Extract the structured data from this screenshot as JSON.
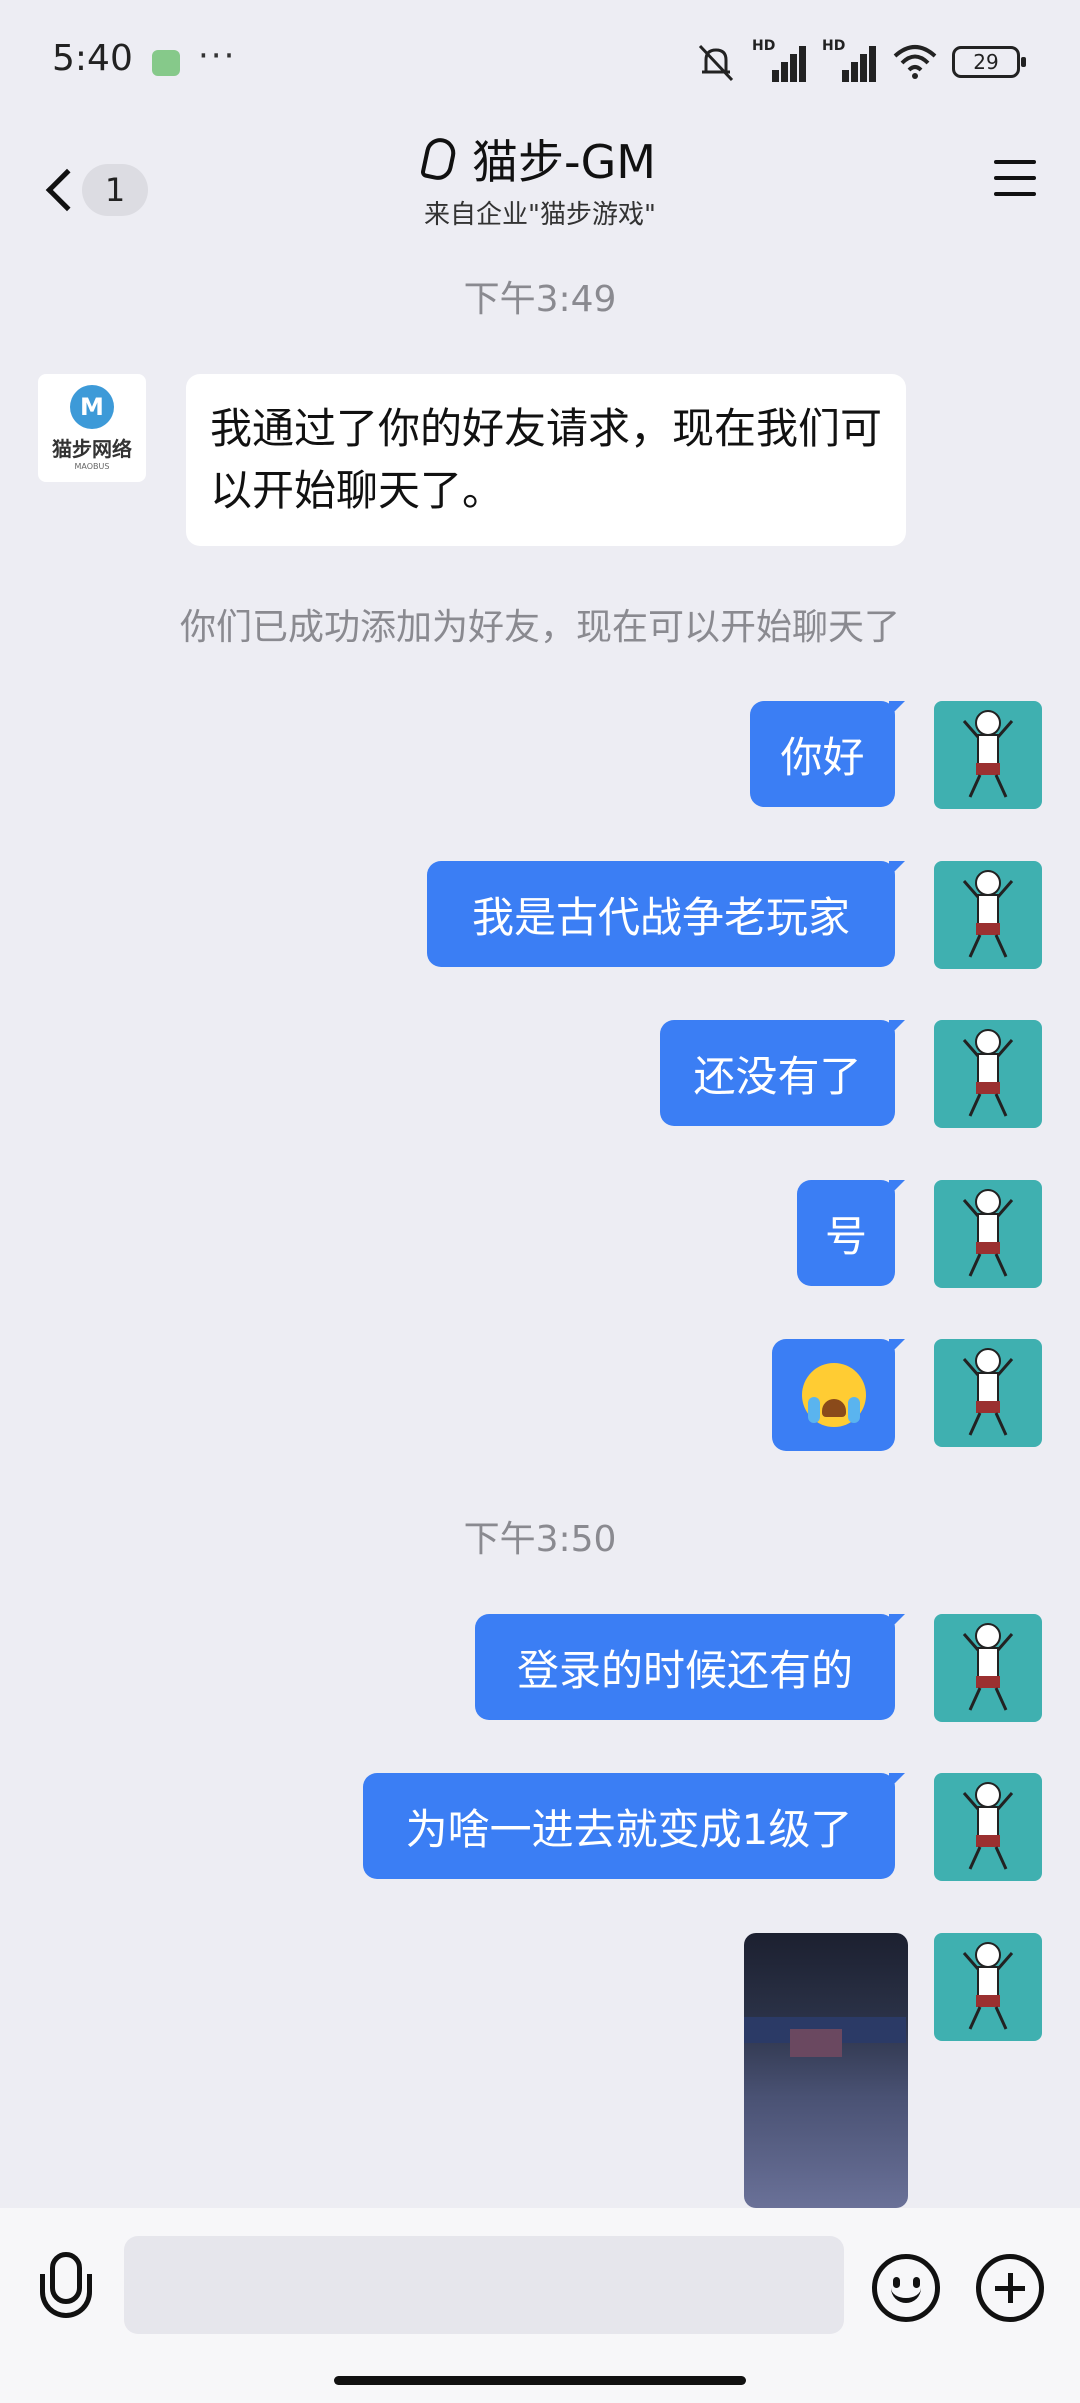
{
  "status_bar": {
    "time": "5:40",
    "dots": "···",
    "signal_1_label": "HD",
    "signal_2_label": "HD",
    "battery": "29"
  },
  "header": {
    "back_count": "1",
    "title": "猫步-GM",
    "subtitle": "来自企业\"猫步游戏\""
  },
  "avatars": {
    "gm_logo_letter": "M",
    "gm_logo_text": "猫步网络",
    "gm_logo_sub": "MAOBUS"
  },
  "chat": {
    "time_1": "下午3:49",
    "incoming_1": "我通过了你的好友请求，现在我们可以开始聊天了。",
    "system_notice": "你们已成功添加为好友，现在可以开始聊天了",
    "out_1": "你好",
    "out_2": "我是古代战争老玩家",
    "out_3": "还没有了",
    "out_4": "号",
    "out_5_emoji": "crying-face",
    "time_2": "下午3:50",
    "out_6": "登录的时候还有的",
    "out_7": "为啥一进去就变成1级了",
    "out_8_type": "image"
  },
  "input": {
    "placeholder": ""
  },
  "colors": {
    "background": "#ededf3",
    "outgoing_bubble": "#3b7ef4",
    "incoming_bubble": "#ffffff",
    "timestamp_text": "#8a8a90"
  }
}
